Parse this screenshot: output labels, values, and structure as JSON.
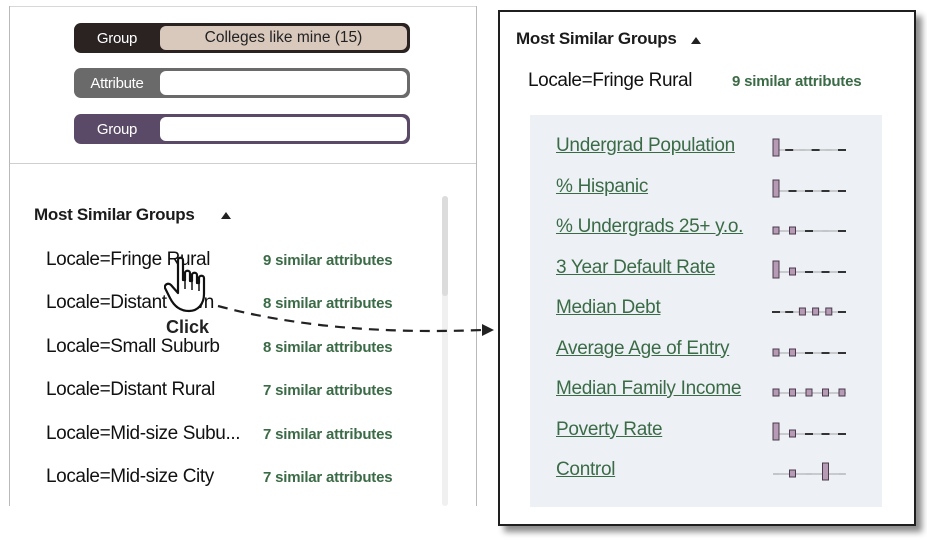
{
  "filters": [
    {
      "tag": "Group",
      "value": "Colleges like mine (15)",
      "color": "#2b2222",
      "value_bg": "#d9c9bd"
    },
    {
      "tag": "Attribute",
      "value": "",
      "color": "#6a6a6a"
    },
    {
      "tag": "Group",
      "value": "",
      "color": "#5a4a67"
    }
  ],
  "left": {
    "heading": "Most Similar Groups",
    "groups": [
      {
        "name": "Locale=Fringe Rural",
        "count": "9 similar attributes"
      },
      {
        "name": "Locale=Distant Town",
        "count": "8 similar attributes"
      },
      {
        "name": "Locale=Small Suburb",
        "count": "8 similar attributes"
      },
      {
        "name": "Locale=Distant Rural",
        "count": "7 similar attributes"
      },
      {
        "name": "Locale=Mid-size Subu...",
        "count": "7 similar attributes"
      },
      {
        "name": "Locale=Mid-size City",
        "count": "7 similar attributes"
      }
    ],
    "click_label": "Click"
  },
  "right": {
    "heading": "Most Similar Groups",
    "group_name": "Locale=Fringe Rural",
    "group_count": "9 similar attributes",
    "attributes": [
      {
        "label": "Undergrad Population",
        "marks": [
          "tall",
          "dash",
          "line",
          "dash",
          "line",
          "dash"
        ]
      },
      {
        "label": "% Hispanic",
        "marks": [
          "tall",
          "dash",
          "dash",
          "dash",
          "dash"
        ]
      },
      {
        "label": "% Undergrads 25+ y.o.",
        "marks": [
          "sq",
          "sq",
          "dash",
          "line",
          "dash"
        ]
      },
      {
        "label": "3 Year Default Rate",
        "marks": [
          "tall",
          "sq",
          "dash",
          "dash",
          "dash"
        ]
      },
      {
        "label": "Median Debt",
        "marks": [
          "dash",
          "dash",
          "sq",
          "sq",
          "sq",
          "dash"
        ]
      },
      {
        "label": "Average Age of Entry",
        "marks": [
          "sq",
          "sq",
          "dash",
          "dash",
          "dash"
        ]
      },
      {
        "label": "Median Family Income",
        "marks": [
          "sq",
          "sq",
          "sq",
          "sq",
          "sq"
        ]
      },
      {
        "label": "Poverty Rate",
        "marks": [
          "tall",
          "sq",
          "dash",
          "dash",
          "dash"
        ]
      },
      {
        "label": "Control",
        "marks": [
          "line",
          "sq",
          "line",
          "tall",
          "line"
        ]
      }
    ]
  },
  "colors": {
    "accent": "#3b6b46",
    "mark_fill": "#b79ab6",
    "mark_stroke": "#4a3a4a"
  }
}
